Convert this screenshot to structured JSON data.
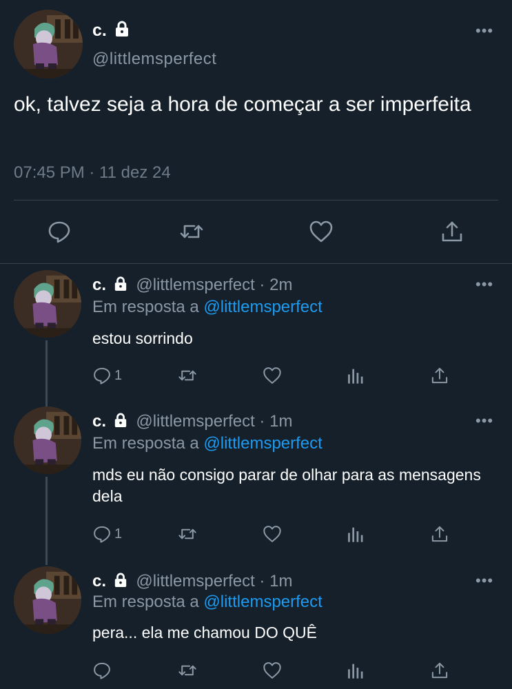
{
  "main_tweet": {
    "name": "c.",
    "handle": "@littlemsperfect",
    "text": "ok, talvez seja a hora de começar a ser imperfeita",
    "timestamp": "07:45 PM · 11 dez 24",
    "more_icon": "more-dots-icon",
    "actions": [
      "reply-icon",
      "retweet-icon",
      "like-icon",
      "share-icon"
    ]
  },
  "replies": [
    {
      "name": "c.",
      "handle_time": "@littlemsperfect · 2m",
      "reply_prefix": "Em resposta a",
      "reply_to": "@littlemsperfect",
      "text": "estou sorrindo",
      "reply_count": "1"
    },
    {
      "name": "c.",
      "handle_time": "@littlemsperfect · 1m",
      "reply_prefix": "Em resposta a",
      "reply_to": "@littlemsperfect",
      "text": "mds eu não consigo parar de olhar para as mensagens dela",
      "reply_count": "1"
    },
    {
      "name": "c.",
      "handle_time": "@littlemsperfect · 1m",
      "reply_prefix": "Em resposta a",
      "reply_to": "@littlemsperfect",
      "text": "pera... ela me chamou DO QUÊ",
      "reply_count": ""
    }
  ],
  "colors": {
    "background": "#15202b",
    "muted": "#8b98a5",
    "link": "#1d9bf0",
    "divider": "#38444d"
  }
}
